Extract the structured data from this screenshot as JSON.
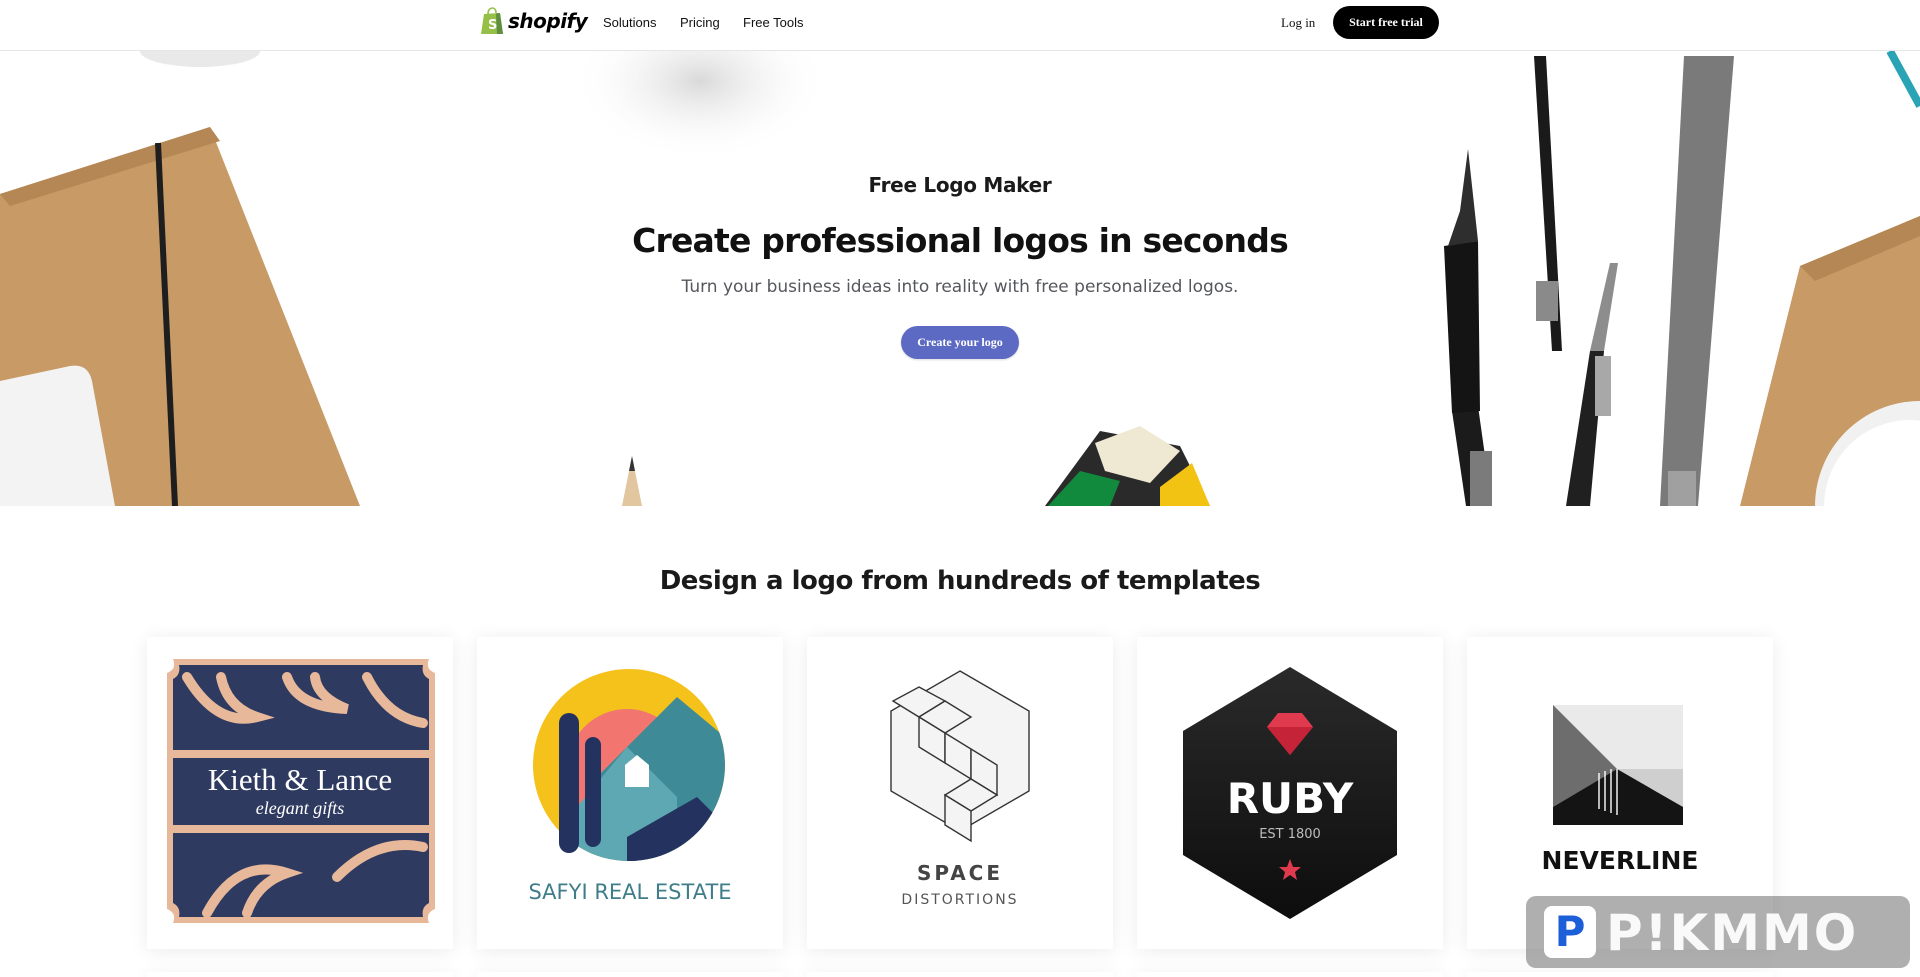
{
  "nav": {
    "brand": "shopify",
    "links": [
      "Solutions",
      "Pricing",
      "Free Tools"
    ],
    "login": "Log in",
    "cta": "Start free trial"
  },
  "hero": {
    "eyebrow": "Free Logo Maker",
    "headline": "Create professional logos in seconds",
    "subhead": "Turn your business ideas into reality with free personalized logos.",
    "cta": "Create your logo"
  },
  "templates": {
    "title": "Design a logo from hundreds of templates",
    "cards": [
      {
        "name": "Kieth & Lance",
        "tagline": "elegant gifts"
      },
      {
        "name": "SAFYI REAL ESTATE"
      },
      {
        "name": "SPACE",
        "tagline": "DISTORTIONS"
      },
      {
        "name": "RUBY",
        "tagline": "EST 1800"
      },
      {
        "name": "NEVERLINE"
      }
    ]
  },
  "watermark": {
    "letter": "P",
    "text": "P!KMMO"
  },
  "colors": {
    "accent": "#5c6ac4",
    "brand_green": "#95bf47",
    "navy": "#2e3a5f",
    "peach": "#e8b89a"
  }
}
